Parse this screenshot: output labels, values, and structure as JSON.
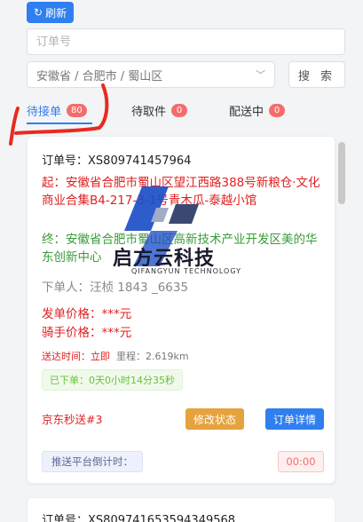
{
  "toolbar": {
    "refresh_label": "刷新"
  },
  "filters": {
    "order_placeholder": "订单号",
    "region_value": "安徽省 / 合肥市 / 蜀山区",
    "search_label": "搜 索"
  },
  "tabs": [
    {
      "label": "待接单",
      "count": "80",
      "active": true
    },
    {
      "label": "待取件",
      "count": "0",
      "active": false
    },
    {
      "label": "配送中",
      "count": "0",
      "active": false
    }
  ],
  "order": {
    "order_no_label": "订单号：",
    "order_no": "XS809741457964",
    "from": "起：安徽省合肥市蜀山区望江西路388号新粮仓·文化商业合集B4-217-3-1号青木瓜-泰越小馆",
    "to": "终：安徽省合肥市蜀山区高新技术产业开发区美的华东创新中心",
    "creator": "下单人：汪桢 1843   _6635",
    "fee_order": "发单价格：***元",
    "fee_rider": "骑手价格：***元",
    "arrive_label": "送达时间：",
    "arrive_value": "立即",
    "distance": "里程：2.619km",
    "elapsed": "已下单：0天0小时14分35秒",
    "platform": "京东秒送#3",
    "edit_label": "修改状态",
    "detail_label": "订单详情",
    "countdown_label": "推送平台倒计时：",
    "countdown_value": "00:00"
  },
  "order2": {
    "order_no_label": "订单号：",
    "order_no": "XS809741653594349568"
  },
  "watermark": {
    "title": "启方云科技",
    "subtitle": "QIFANGYUN TECHNOLOGY"
  },
  "colors": {
    "accent": "#2f7ff0",
    "danger": "#e02020",
    "success": "#3a9b3a",
    "warning": "#e6a23c"
  }
}
